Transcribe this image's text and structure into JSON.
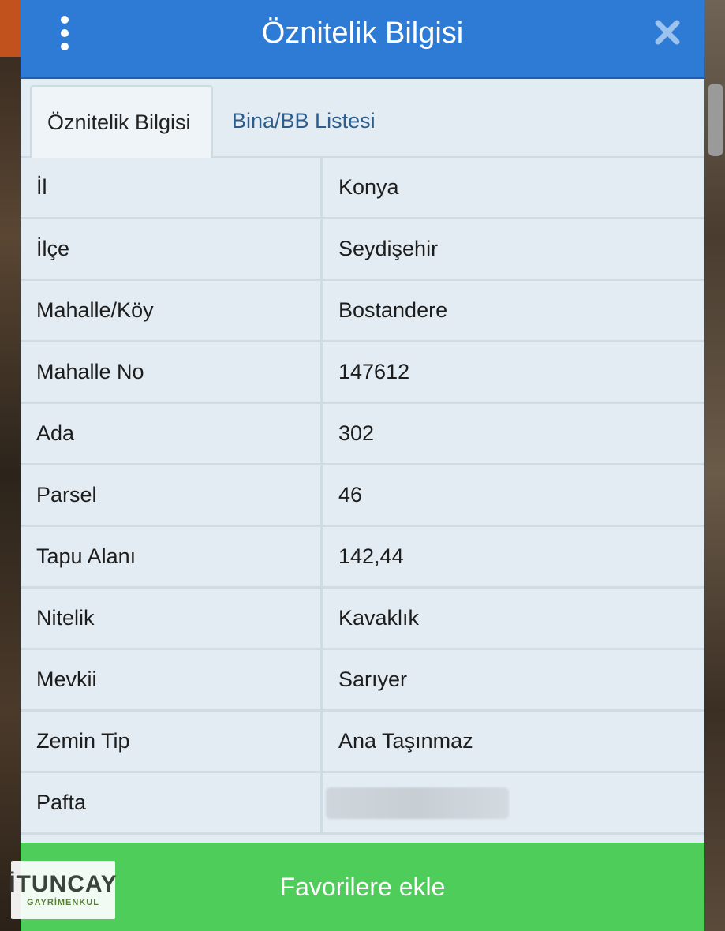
{
  "header": {
    "title": "Öznitelik Bilgisi",
    "menu_icon": "vertical-dots-icon",
    "close_icon": "close-icon"
  },
  "tabs": [
    {
      "label": "Öznitelik Bilgisi",
      "active": true
    },
    {
      "label": "Bina/BB Listesi",
      "active": false
    }
  ],
  "attributes": [
    {
      "label": "İl",
      "value": "Konya"
    },
    {
      "label": "İlçe",
      "value": "Seydişehir"
    },
    {
      "label": "Mahalle/Köy",
      "value": "Bostandere"
    },
    {
      "label": "Mahalle No",
      "value": "147612"
    },
    {
      "label": "Ada",
      "value": "302"
    },
    {
      "label": "Parsel",
      "value": "46"
    },
    {
      "label": "Tapu Alanı",
      "value": "142,44"
    },
    {
      "label": "Nitelik",
      "value": "Kavaklık"
    },
    {
      "label": "Mevkii",
      "value": "Sarıyer"
    },
    {
      "label": "Zemin Tip",
      "value": "Ana Taşınmaz"
    },
    {
      "label": "Pafta",
      "value": ""
    }
  ],
  "actions": {
    "favorite_label": "Favorilere ekle"
  },
  "logo": {
    "main": "İTUNCAY",
    "sub": "GAYRİMENKUL"
  },
  "colors": {
    "header": "#2e7bd6",
    "favorite_button": "#4fcd5a",
    "panel": "#e2ecf2",
    "tab_inactive_text": "#2c5d8c"
  }
}
